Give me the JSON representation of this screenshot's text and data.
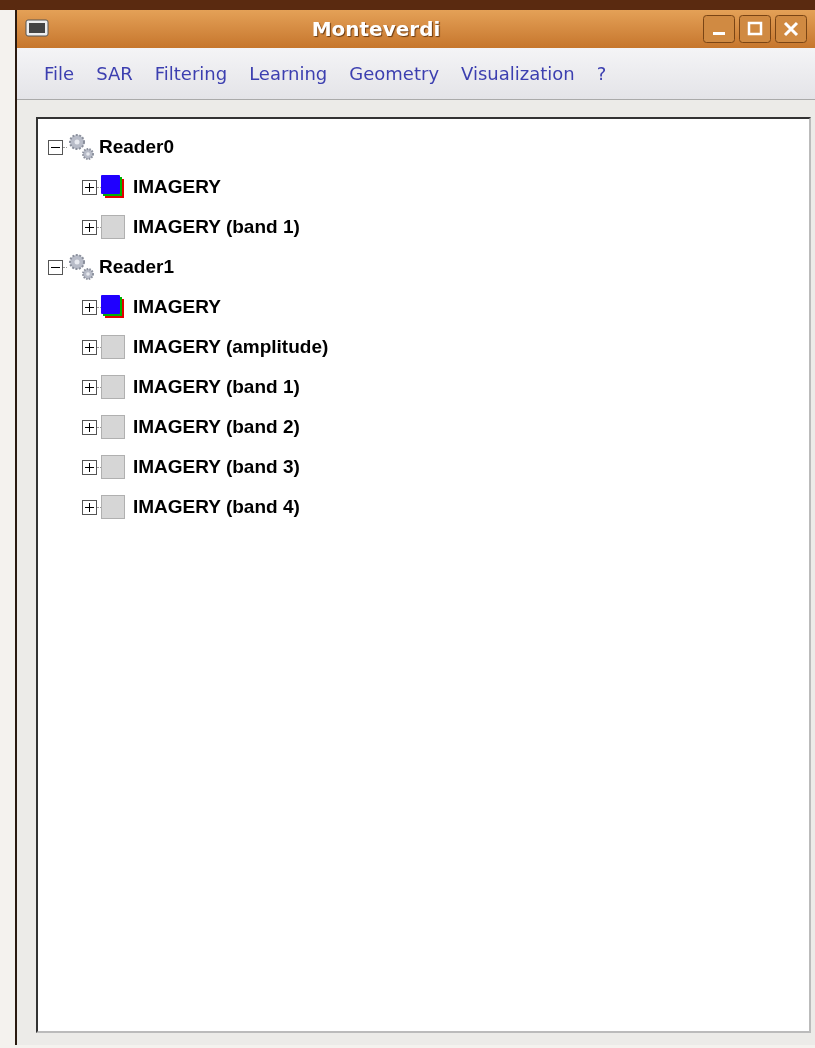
{
  "window": {
    "title": "Monteverdi"
  },
  "menu": [
    "File",
    "SAR",
    "Filtering",
    "Learning",
    "Geometry",
    "Visualization",
    "?"
  ],
  "tree": [
    {
      "label": "Reader0",
      "kind": "reader",
      "expanded": true,
      "children": [
        {
          "label": "IMAGERY",
          "kind": "color",
          "expanded": false
        },
        {
          "label": "IMAGERY (band 1)",
          "kind": "gray",
          "expanded": false
        }
      ]
    },
    {
      "label": "Reader1",
      "kind": "reader",
      "expanded": true,
      "children": [
        {
          "label": "IMAGERY",
          "kind": "color",
          "expanded": false
        },
        {
          "label": "IMAGERY (amplitude)",
          "kind": "gray",
          "expanded": false
        },
        {
          "label": "IMAGERY (band 1)",
          "kind": "gray",
          "expanded": false
        },
        {
          "label": "IMAGERY (band 2)",
          "kind": "gray",
          "expanded": false
        },
        {
          "label": "IMAGERY (band 3)",
          "kind": "gray",
          "expanded": false
        },
        {
          "label": "IMAGERY (band 4)",
          "kind": "gray",
          "expanded": false
        }
      ]
    }
  ]
}
